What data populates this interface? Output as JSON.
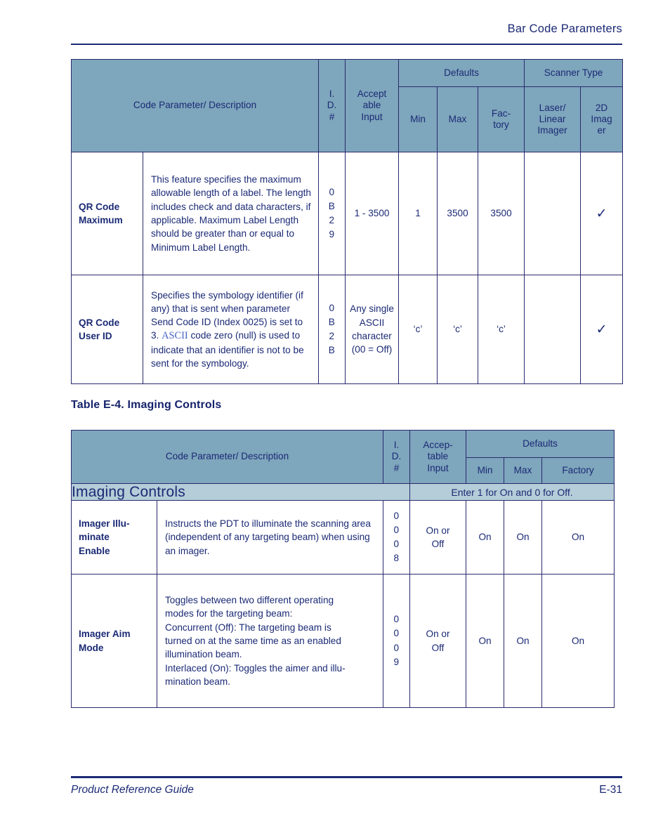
{
  "page": {
    "running_header": "Bar Code Parameters",
    "footer_left": "Product Reference Guide",
    "footer_right": "E-31"
  },
  "table1": {
    "headers": {
      "code_parameter": "Code Parameter/ Description",
      "id": "I.\nD.\n#",
      "id_l1": "I.",
      "id_l2": "D.",
      "id_l3": "#",
      "acceptable_input_l1": "Accept",
      "acceptable_input_l2": "able",
      "acceptable_input_l3": "Input",
      "defaults": "Defaults",
      "scanner_type": "Scanner Type",
      "min": "Min",
      "max": "Max",
      "factory_l1": "Fac-",
      "factory_l2": "tory",
      "laser_l1": "Laser/",
      "laser_l2": "Linear",
      "laser_l3": "Imager",
      "imager2d_l1": "2D",
      "imager2d_l2": "Imag",
      "imager2d_l3": "er"
    },
    "rows": [
      {
        "name_l1": "QR Code",
        "name_l2": "Maximum",
        "description": "This feature specifies the maximum allowable length of a label. The length includes check and data characters, if applicable. Maximum Label Length should be greater than or equal to Minimum Label Length.",
        "id": "0 B 2 9",
        "id_digits": [
          "0",
          "B",
          "2",
          "9"
        ],
        "acceptable_input": "1 - 3500",
        "min": "1",
        "max": "3500",
        "factory": "3500",
        "laser_linear_imager": "",
        "imager_2d": "✓"
      },
      {
        "name_l1": "QR Code",
        "name_l2": "User ID",
        "description_pre": "Specifies the symbology identifier (if any) that is sent when parameter Send Code ID (Index 0025) is set to 3. ",
        "description_xref": "ASCII",
        "description_post": " code zero (null) is used to indicate that an identifier is not to be sent for the symbology.",
        "id": "0 B 2 B",
        "id_digits": [
          "0",
          "B",
          "2",
          "B"
        ],
        "acceptable_input": "Any single ASCII character (00 = Off)",
        "min": "‘c’",
        "max": "‘c’",
        "factory": "‘c’",
        "laser_linear_imager": "",
        "imager_2d": "✓"
      }
    ]
  },
  "caption2": "Table E-4. Imaging Controls",
  "table2": {
    "headers": {
      "code_parameter": "Code Parameter/ Description",
      "id_l1": "I.",
      "id_l2": "D.",
      "id_l3": "#",
      "acceptable_input_l1": "Accep-",
      "acceptable_input_l2": "table",
      "acceptable_input_l3": "Input",
      "defaults": "Defaults",
      "min": "Min",
      "max": "Max",
      "factory": "Factory"
    },
    "band": {
      "title": "Imaging Controls",
      "note": "Enter 1 for On and 0 for Off."
    },
    "rows": [
      {
        "name_l1": "Imager Illu-",
        "name_l2": "minate",
        "name_l3": "Enable",
        "description": "Instructs the PDT to illuminate the scanning area (independent of any targeting beam) when using an imager.",
        "id": "0 0 0 8",
        "id_digits": [
          "0",
          "0",
          "0",
          "8"
        ],
        "acceptable_input_l1": "On or",
        "acceptable_input_l2": "Off",
        "min": "On",
        "max": "On",
        "factory": "On"
      },
      {
        "name_l1": "Imager Aim",
        "name_l2": "Mode",
        "name_l3": "",
        "description": "Toggles between two different operating modes for the targeting beam:\nConcurrent (Off): The targeting beam is turned on at the same time as an enabled illumination beam.\nInterlaced (On): Toggles the aimer and illumination beam.",
        "description_lines": [
          "Toggles between two different operating",
          "modes for the targeting beam:",
          "Concurrent (Off): The targeting beam is",
          "turned on at the same time as an enabled",
          "illumination beam.",
          "Interlaced (On): Toggles the aimer and illu-",
          "mination beam."
        ],
        "id": "0 0 0 9",
        "id_digits": [
          "0",
          "0",
          "0",
          "9"
        ],
        "acceptable_input_l1": "On or",
        "acceptable_input_l2": "Off",
        "min": "On",
        "max": "On",
        "factory": "On"
      }
    ]
  },
  "colors": {
    "header_fill": "#7ea6bc",
    "band_fill": "#b4cdd8",
    "text": "#1b2a75",
    "xref": "#4a63c8",
    "rule": "#1b2a75"
  }
}
